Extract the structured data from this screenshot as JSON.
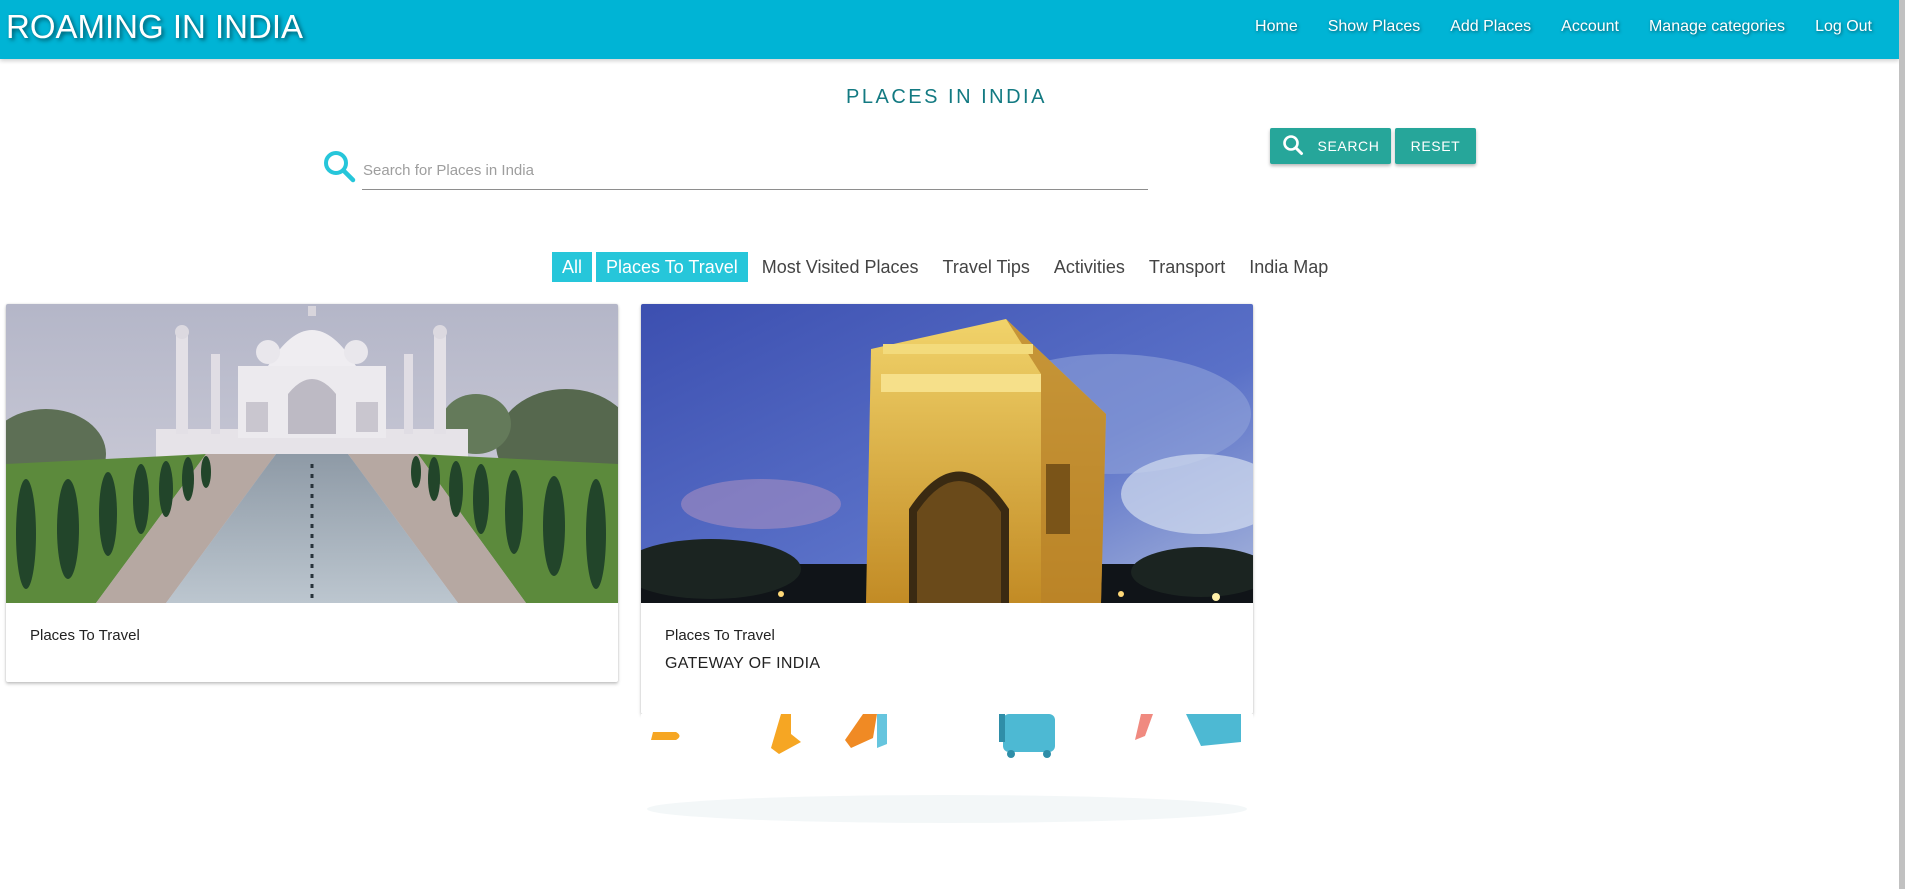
{
  "app": {
    "brand": "ROAMING IN INDIA",
    "accent_color": "#00b4d5",
    "button_color": "#26a69a",
    "chip_color": "#26c6da"
  },
  "nav": {
    "links": [
      "Home",
      "Show Places",
      "Add Places",
      "Account",
      "Manage categories",
      "Log Out"
    ]
  },
  "main": {
    "title": "PLACES IN INDIA",
    "search": {
      "placeholder": "Search for Places in India",
      "value": "",
      "icon": "search-icon"
    },
    "buttons": {
      "search": "SEARCH",
      "reset": "RESET"
    },
    "categories": [
      {
        "label": "All",
        "active": true
      },
      {
        "label": "Places To Travel",
        "active": true
      },
      {
        "label": "Most Visited Places",
        "active": false
      },
      {
        "label": "Travel Tips",
        "active": false
      },
      {
        "label": "Activities",
        "active": false
      },
      {
        "label": "Transport",
        "active": false
      },
      {
        "label": "India Map",
        "active": false
      }
    ],
    "cards": [
      {
        "category": "Places To Travel",
        "title": "",
        "image": "taj-mahal-photo"
      },
      {
        "category": "Places To Travel",
        "title": "GATEWAY OF INDIA",
        "image": "india-gate-photo"
      }
    ]
  }
}
